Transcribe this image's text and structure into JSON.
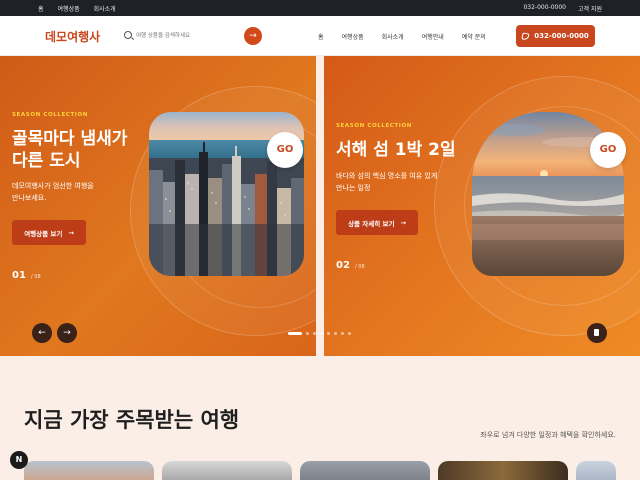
{
  "topbar": {
    "left_links": [
      "홈",
      "여행상품",
      "회사소개"
    ],
    "phone": "032-000-0000",
    "support": "고객 지원"
  },
  "header": {
    "logo": "데모여행사",
    "search_placeholder": "여행 상품을 검색하세요",
    "search_icon": "search-icon",
    "search_submit_icon": "arrow-right-icon",
    "nav": [
      "홈",
      "여행상품",
      "회사소개",
      "여행안내",
      "예약 문의"
    ],
    "call_button": "032-000-0000",
    "call_icon": "phone-icon"
  },
  "hero": {
    "slides": [
      {
        "eyebrow": "SEASON COLLECTION",
        "title_line1": "골목마다 냄새가",
        "title_line2": "다른 도시",
        "desc_line1": "데모여행사가 엄선한 여행을",
        "desc_line2": "만나보세요.",
        "cta": "여행상품 보기",
        "cta_icon": "arrow-right-icon",
        "counter_current": "01",
        "counter_total": "/ 08",
        "go_label": "GO",
        "image": "city-skyline-photo"
      },
      {
        "eyebrow": "SEASON COLLECTION",
        "title": "서해 섬 1박 2일",
        "desc_line1": "바다와 섬의 핵심 명소를 여유 있게",
        "desc_line2": "만나는 일정",
        "cta": "상품 자세히 보기",
        "cta_icon": "arrow-right-icon",
        "counter_current": "02",
        "counter_total": "/ 08",
        "go_label": "GO",
        "image": "sunset-beach-photo"
      }
    ],
    "prev_label": "←",
    "next_label": "→",
    "total_dots": 8,
    "active_dot": 1
  },
  "section": {
    "title": "지금 가장 주목받는 여행",
    "desc": "좌우로 넘겨 다양한 일정과 혜택을 확인하세요."
  },
  "fab_label": "N",
  "colors": {
    "brand": "#c9471e",
    "hero_orange": "#e0781f",
    "accent_yellow": "#ffd23a",
    "dark": "#1f2129",
    "section_bg": "#fbeee6"
  }
}
